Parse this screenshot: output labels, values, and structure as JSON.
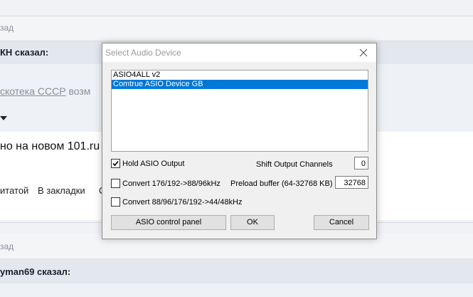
{
  "background": {
    "rows": [
      {
        "text": "зад"
      },
      {
        "text": "КН сказал:"
      },
      {
        "link": "скотека СССР",
        "after": " возм"
      },
      {
        "text": "но на новом 101.ru"
      },
      {
        "actions": [
          "итатой",
          "В закладки",
          "С"
        ]
      },
      {
        "text": "зад"
      },
      {
        "text": "yman69 сказал:"
      }
    ]
  },
  "dialog": {
    "title": "Select Audio Device",
    "devices": [
      "ASIO4ALL v2",
      "Comtrue ASIO Device GB"
    ],
    "selected_index": 1,
    "hold_asio_output": {
      "label": "Hold ASIO Output",
      "checked": true
    },
    "shift_output_channels": {
      "label": "Shift Output Channels",
      "value": "0"
    },
    "convert_176": {
      "label": "Convert 176/192->88/96kHz",
      "checked": false
    },
    "preload_buffer": {
      "label": "Preload buffer (64-32768 KB)",
      "value": "32768"
    },
    "convert_88": {
      "label": "Convert 88/96/176/192->44/48kHz",
      "checked": false
    },
    "buttons": {
      "asio_panel": "ASIO control panel",
      "ok": "OK",
      "cancel": "Cancel"
    }
  }
}
